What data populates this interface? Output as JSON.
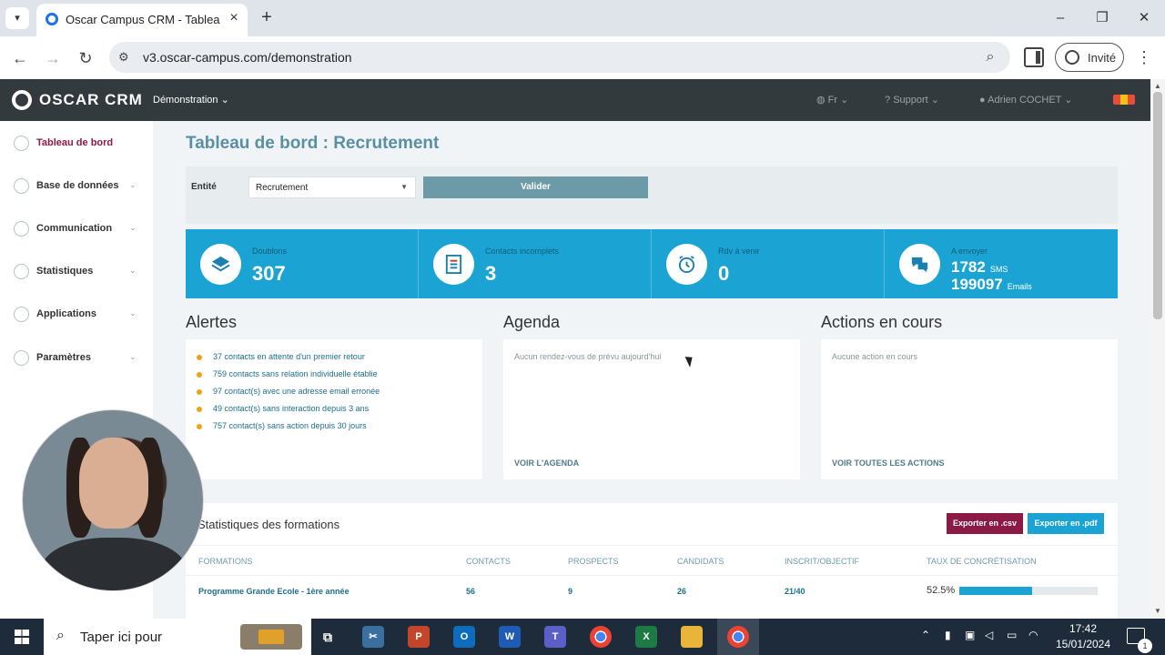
{
  "browser": {
    "tab_title": "Oscar Campus CRM - Tableau de",
    "url": "v3.oscar-campus.com/demonstration",
    "profile_label": "Invité"
  },
  "app_header": {
    "logo": "OSCAR CRM",
    "account": "Démonstration",
    "language": "Fr",
    "support": "Support",
    "user": "Adrien COCHET"
  },
  "sidebar": {
    "items": [
      {
        "label": "Tableau de bord",
        "icon": "dashboard-icon"
      },
      {
        "label": "Base de données",
        "icon": "database-icon"
      },
      {
        "label": "Communication",
        "icon": "communication-icon"
      },
      {
        "label": "Statistiques",
        "icon": "statistics-icon"
      },
      {
        "label": "Applications",
        "icon": "applications-icon"
      },
      {
        "label": "Paramètres",
        "icon": "settings-icon"
      }
    ]
  },
  "main": {
    "title": "Tableau de bord : Recrutement",
    "filter": {
      "entity_label": "Entité",
      "entity_value": "Recrutement",
      "validate_label": "Valider"
    },
    "stats": [
      {
        "label": "Doublons",
        "value": "307",
        "icon": "layers-icon"
      },
      {
        "label": "Contacts incomplets",
        "value": "3",
        "icon": "form-icon"
      },
      {
        "label": "Rdv à venir",
        "value": "0",
        "icon": "alarm-clock-icon"
      },
      {
        "label": "A envoyer",
        "sms_value": "1782",
        "sms_unit": "SMS",
        "email_value": "199097",
        "email_unit": "Emails",
        "icon": "chat-bubbles-icon"
      }
    ],
    "alerts": {
      "title": "Alertes",
      "items": [
        "37 contacts en attente d'un premier retour",
        "759 contacts sans relation individuelle établie",
        "97 contact(s) avec une adresse email erronée",
        "49 contact(s) sans interaction depuis 3 ans",
        "757 contact(s) sans action depuis 30 jours"
      ]
    },
    "agenda": {
      "title": "Agenda",
      "empty": "Aucun rendez-vous de prévu aujourd'hui",
      "link": "VOIR L'AGENDA"
    },
    "actions": {
      "title": "Actions en cours",
      "empty": "Aucune action en cours",
      "link": "VOIR TOUTES LES ACTIONS"
    },
    "formations": {
      "title": "Statistiques des formations",
      "export_csv": "Exporter en .csv",
      "export_pdf": "Exporter en .pdf",
      "columns": [
        "FORMATIONS",
        "CONTACTS",
        "PROSPECTS",
        "CANDIDATS",
        "INSCRIT/OBJECTIF",
        "TAUX DE CONCRÉTISATION"
      ],
      "rows": [
        {
          "name": "Programme Grande Ecole - 1ère année",
          "contacts": "56",
          "prospects": "9",
          "candidats": "26",
          "inscrit": "21/40",
          "rate": "52.5%",
          "rate_value": 0.525
        }
      ]
    }
  },
  "taskbar": {
    "search_placeholder": "Taper ici pour",
    "time": "17:42",
    "date": "15/01/2024",
    "notification_count": "1"
  },
  "colors": {
    "accent": "#1ba4d3",
    "brand_dark": "#333a3d",
    "csv_button": "#8b1a47",
    "alert_dot": "#f0a21b"
  }
}
